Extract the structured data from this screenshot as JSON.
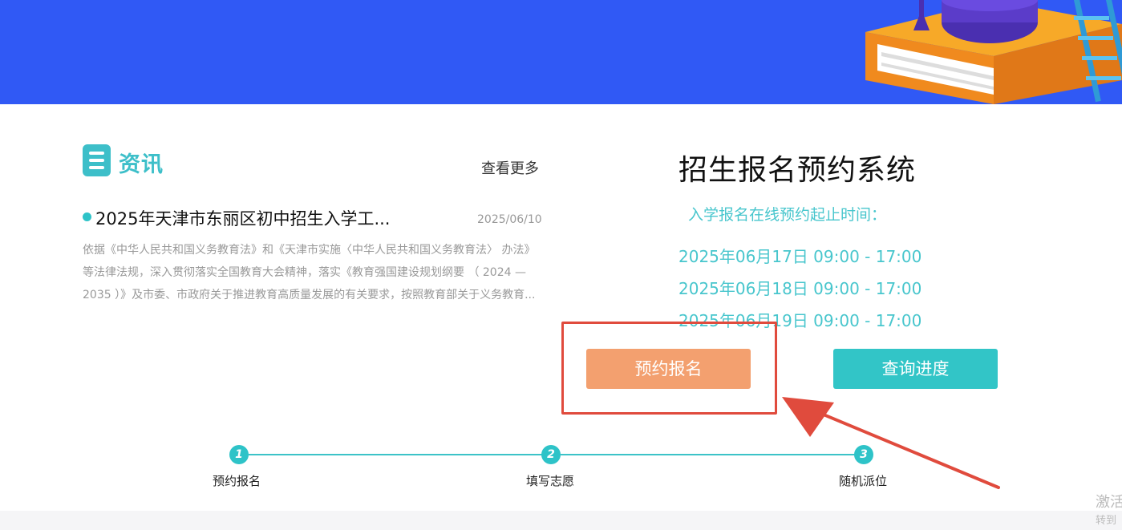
{
  "news": {
    "title": "资讯",
    "more_label": "查看更多",
    "item": {
      "title": "2025年天津市东丽区初中招生入学工...",
      "date": "2025/06/10",
      "summary": "依据《中华人民共和国义务教育法》和《天津市实施〈中华人民共和国义务教育法〉 办法》等法律法规，深入贯彻落实全国教育大会精神，落实《教育强国建设规划纲要 （ 2024 — 2035 ）》及市委、市政府关于推进教育高质量发展的有关要求，按照教育部关于义务教育..."
    }
  },
  "system": {
    "title": "招生报名预约系统",
    "period_label": "入学报名在线预约起止时间：",
    "times": [
      "2025年06月17日 09:00 - 17:00",
      "2025年06月18日 09:00 - 17:00",
      "2025年06月19日 09:00 - 17:00"
    ],
    "book_button": "预约报名",
    "query_button": "查询进度"
  },
  "steps": [
    {
      "number": "1",
      "label": "预约报名"
    },
    {
      "number": "2",
      "label": "填写志愿"
    },
    {
      "number": "3",
      "label": "随机派位"
    }
  ],
  "watermark": {
    "line1": "激活",
    "line2": "转到"
  },
  "colors": {
    "banner": "#3059f5",
    "teal": "#2ec3c8",
    "book_button": "#f3a06f",
    "query_button": "#32c5c7",
    "highlight": "#e04b3d"
  }
}
